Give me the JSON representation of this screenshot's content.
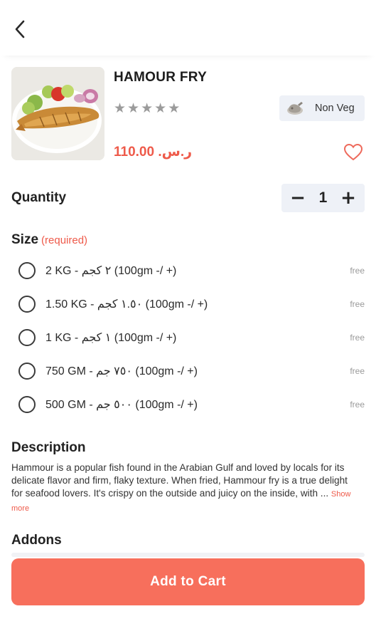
{
  "icons": {
    "back": "chevron-left-icon",
    "rating": "star-icon",
    "category": "chicken-leg-icon",
    "favorite": "heart-outline-icon",
    "decrease": "minus-icon",
    "increase": "plus-icon",
    "radio": "radio-unchecked-icon"
  },
  "colors": {
    "accent": "#ee5a4a",
    "cart_button": "#f76f5c",
    "chip_bg": "#eef1f7",
    "star": "#9b9b9b"
  },
  "product": {
    "name": "HAMOUR FRY",
    "rating": 0,
    "rating_max": 5,
    "category_label": "Non Veg",
    "price": "110.00 .ر.س"
  },
  "quantity": {
    "label": "Quantity",
    "decrease_label": "−",
    "increase_label": "+",
    "value": "1"
  },
  "size": {
    "title": "Size",
    "required_label": "(required)",
    "options": [
      {
        "label": "2 KG - ٢ كجم (100gm -/ +)",
        "price": "free"
      },
      {
        "label": "1.50 KG - ١.٥٠ كجم (100gm -/ +)",
        "price": "free"
      },
      {
        "label": "1 KG - ١ كجم (100gm -/ +)",
        "price": "free"
      },
      {
        "label": "750 GM - ٧٥٠ جم (100gm -/ +)",
        "price": "free"
      },
      {
        "label": "500 GM - ٥٠٠ جم (100gm -/ +)",
        "price": "free"
      }
    ]
  },
  "description": {
    "title": "Description",
    "text": "Hammour is a popular fish found in the Arabian Gulf and loved by locals for its delicate flavor and firm, flaky texture. When fried, Hammour fry is a true delight for seafood lovers. It's crispy on the outside and juicy on the inside, with ...",
    "show_more": "Show more"
  },
  "addons": {
    "title": "Addons"
  },
  "cart": {
    "button_label": "Add to Cart"
  }
}
